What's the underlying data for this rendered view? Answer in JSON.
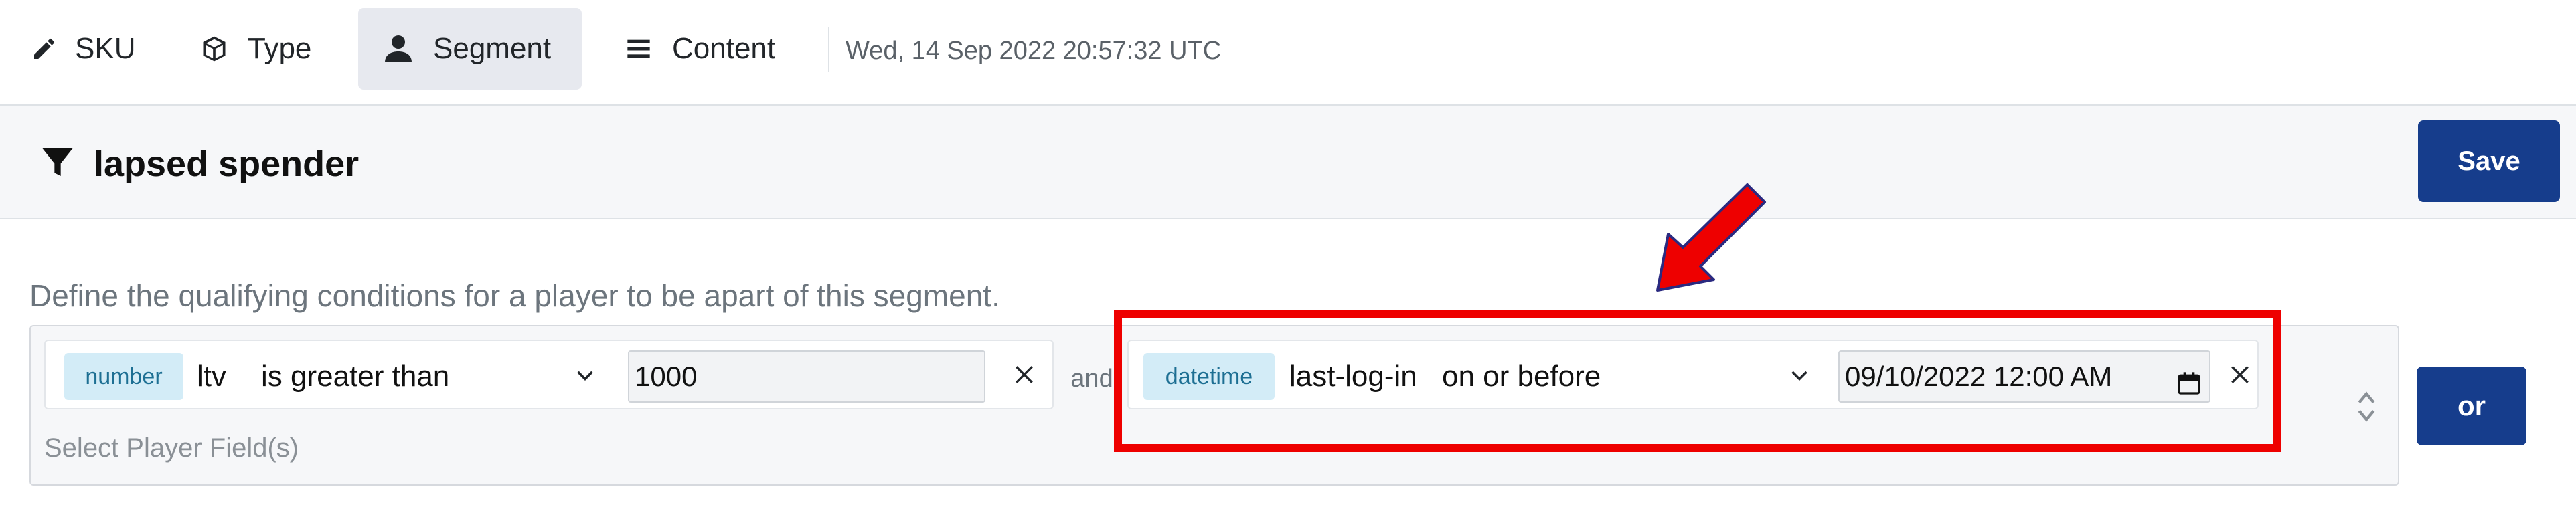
{
  "tabs": [
    {
      "label": "SKU",
      "icon": "pencil-icon",
      "active": false
    },
    {
      "label": "Type",
      "icon": "cube-icon",
      "active": false
    },
    {
      "label": "Segment",
      "icon": "user-icon",
      "active": true
    },
    {
      "label": "Content",
      "icon": "list-icon",
      "active": false
    }
  ],
  "timestamp": "Wed, 14 Sep 2022 20:57:32 UTC",
  "header": {
    "title": "lapsed spender",
    "icon": "filter-icon",
    "save_label": "Save"
  },
  "description": "Define the qualifying conditions for a player to be apart of this segment.",
  "conditions": [
    {
      "type_badge": "number",
      "field": "ltv",
      "operator": "is greater than",
      "value": "1000"
    },
    {
      "type_badge": "datetime",
      "field": "last-log-in",
      "operator": "on or before",
      "value": "09/10/2022 12:00 AM"
    }
  ],
  "joiner": "and",
  "select_fields_placeholder": "Select Player Field(s)",
  "or_label": "or",
  "colors": {
    "primary": "#163d8c",
    "badge_bg": "#d3ecf7",
    "badge_text": "#1d6f93",
    "annotation": "#ee0000"
  }
}
